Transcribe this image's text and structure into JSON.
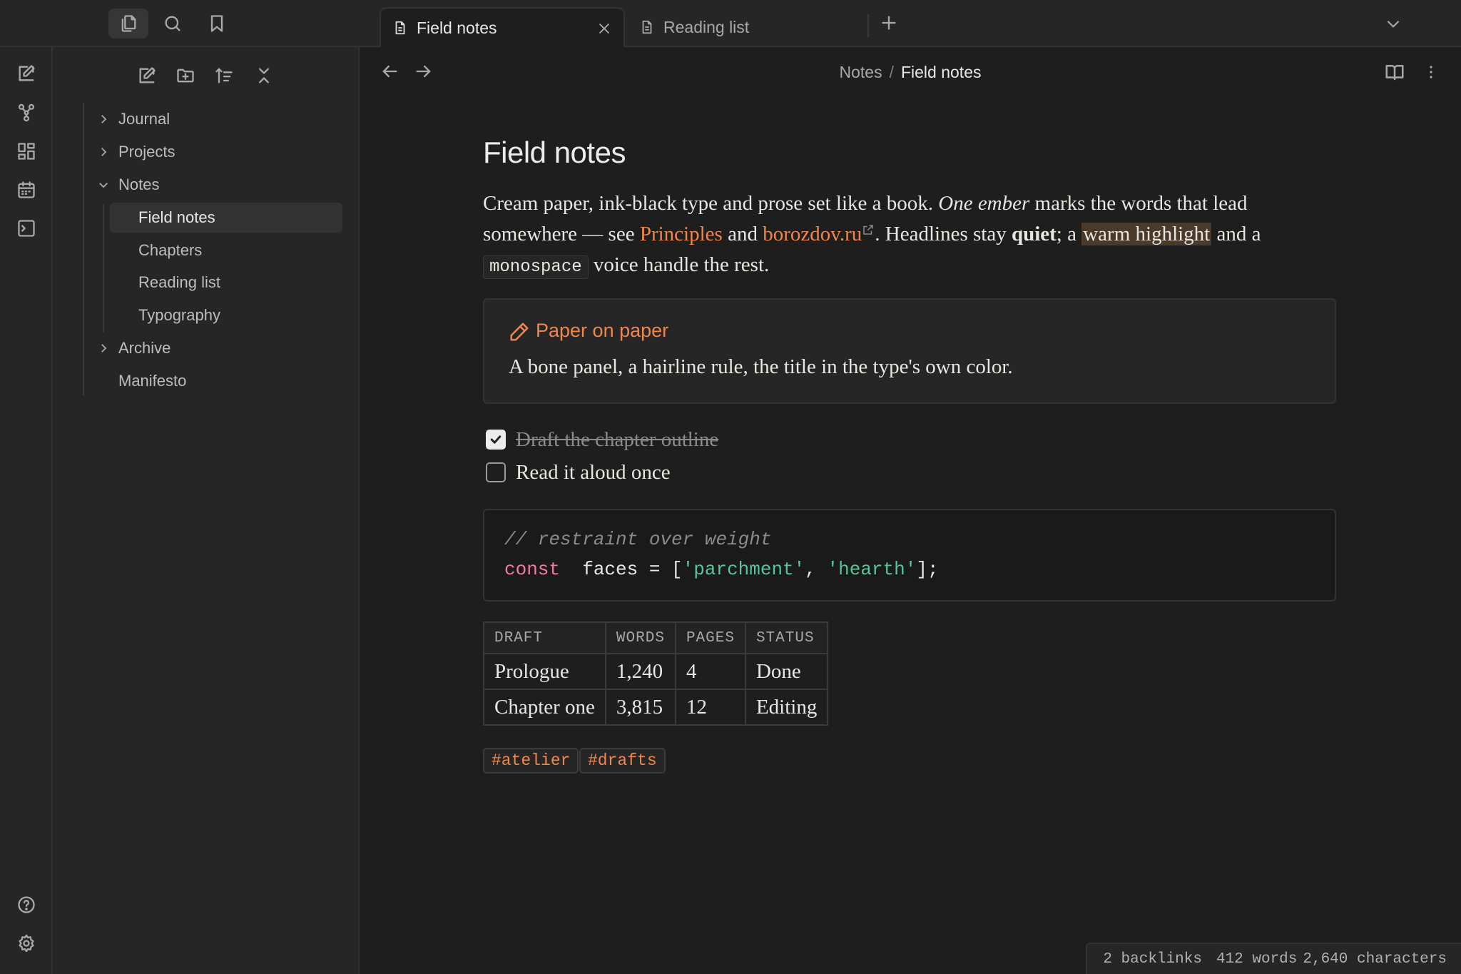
{
  "tabs": [
    {
      "label": "Field notes",
      "active": true
    },
    {
      "label": "Reading list",
      "active": false
    }
  ],
  "breadcrumb": {
    "parent": "Notes",
    "separator": "/",
    "current": "Field notes"
  },
  "file_tree": {
    "items": [
      {
        "label": "Journal",
        "type": "folder",
        "expanded": false
      },
      {
        "label": "Projects",
        "type": "folder",
        "expanded": false
      },
      {
        "label": "Notes",
        "type": "folder",
        "expanded": true
      },
      {
        "label": "Field notes",
        "type": "file",
        "selected": true
      },
      {
        "label": "Chapters",
        "type": "file"
      },
      {
        "label": "Reading list",
        "type": "file"
      },
      {
        "label": "Typography",
        "type": "file"
      },
      {
        "label": "Archive",
        "type": "folder",
        "expanded": false
      },
      {
        "label": "Manifesto",
        "type": "file"
      }
    ]
  },
  "note": {
    "title": "Field notes",
    "para": {
      "p1": "Cream paper, ink-black type and prose set like a book. ",
      "em": "One ember",
      "p2": " marks the words that lead somewhere — see ",
      "link1": "Principles",
      "p3": " and ",
      "link2": "borozdov.ru",
      "p4": ". Headlines stay ",
      "strong": "quiet",
      "p5": "; a ",
      "highlight": "warm highlight",
      "p6": " and a ",
      "code": "monospace",
      "p7": " voice handle the rest."
    },
    "callout": {
      "title": "Paper on paper",
      "body": "A bone panel, a hairline rule, the title in the type's own color."
    },
    "tasks": [
      {
        "label": "Draft the chapter outline",
        "done": true
      },
      {
        "label": "Read it aloud once",
        "done": false
      }
    ],
    "code": {
      "comment": "// restraint over weight",
      "kw": "const",
      "ident": " faces = [",
      "s1": "'parchment'",
      "mid": ", ",
      "s2": "'hearth'",
      "end": "];"
    },
    "table": {
      "headers": [
        "DRAFT",
        "WORDS",
        "PAGES",
        "STATUS"
      ],
      "rows": [
        [
          "Prologue",
          "1,240",
          "4",
          "Done"
        ],
        [
          "Chapter one",
          "3,815",
          "12",
          "Editing"
        ]
      ]
    },
    "tags": [
      "#atelier",
      "#drafts"
    ]
  },
  "status": {
    "backlinks": "2 backlinks",
    "words": "412 words",
    "chars": "2,640 characters"
  },
  "colors": {
    "accent": "#f2864a",
    "bg": "#1e1e1e",
    "panel": "#262626"
  }
}
